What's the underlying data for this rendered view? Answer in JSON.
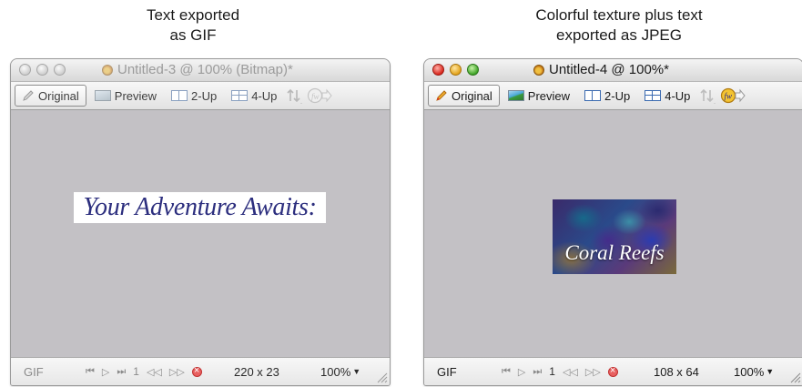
{
  "captions": {
    "left": [
      "Text exported",
      "as GIF"
    ],
    "right": [
      "Colorful texture plus text",
      "exported as JPEG"
    ]
  },
  "windows": [
    {
      "title": "Untitled-3 @ 100% (Bitmap)*",
      "state": "inactive",
      "tabs": [
        "Original",
        "Preview",
        "2-Up",
        "4-Up"
      ],
      "selected_tab": "Original",
      "canvas_text": "Your Adventure Awaits:",
      "status": {
        "format": "GIF",
        "frame_number": "1",
        "dimensions": "220 x 23",
        "zoom": "100%"
      }
    },
    {
      "title": "Untitled-4 @ 100%*",
      "state": "active",
      "tabs": [
        "Original",
        "Preview",
        "2-Up",
        "4-Up"
      ],
      "selected_tab": "Original",
      "canvas_text": "Coral Reefs",
      "status": {
        "format": "GIF",
        "frame_number": "1",
        "dimensions": "108 x 64",
        "zoom": "100%"
      }
    }
  ],
  "icons": {
    "traffic_lights": [
      "close",
      "minimize",
      "zoom"
    ],
    "toolbar": [
      "pencil-icon",
      "preview-icon",
      "two-up-icon",
      "four-up-icon",
      "export-arrows-icon",
      "fireworks-launch-icon"
    ],
    "status": [
      "first-frame-icon",
      "play-icon",
      "last-frame-icon",
      "prev-frame-icon",
      "next-frame-icon",
      "stop-icon",
      "resize-grip-icon"
    ]
  },
  "colors": {
    "canvas_bg": "#c3c1c5",
    "gif_text": "#2c2e7e",
    "close": "#d9251b",
    "minimize": "#e2a21a",
    "zoom": "#3fa427"
  }
}
